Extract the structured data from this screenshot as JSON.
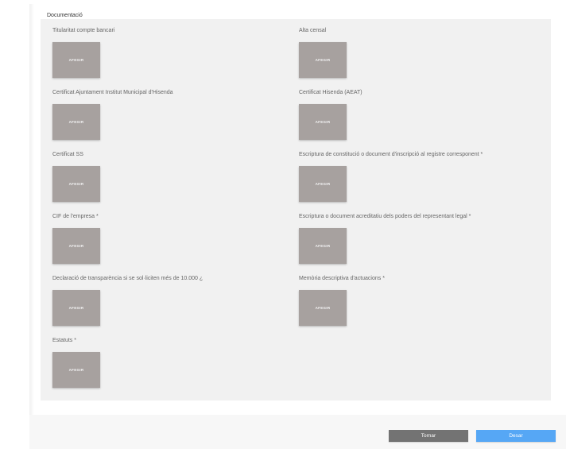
{
  "section": {
    "title": "Documentació"
  },
  "add_label": "AFEGIR",
  "documents": [
    {
      "label": "Titularitat compte bancari"
    },
    {
      "label": "Alta censal"
    },
    {
      "label": "Certificat Ajuntament Institut Municipal d'Hisenda"
    },
    {
      "label": "Certificat Hisenda (AEAT)"
    },
    {
      "label": "Certificat SS"
    },
    {
      "label": "Escriptura de constitució o document d'inscripció al registre corresponent *"
    },
    {
      "label": "CIF de l'empresa *"
    },
    {
      "label": "Escriptura o document acreditatiu dels poders del representant legal *"
    },
    {
      "label": "Declaració de transparència si se sol·liciten més de 10.000 ¿"
    },
    {
      "label": "Memòria descriptiva d'actuacions *"
    },
    {
      "label": "Estatuts *"
    }
  ],
  "footer": {
    "back_label": "Tornar",
    "save_label": "Desar"
  },
  "colors": {
    "panel": "#f1f1f1",
    "add_button": "#a7a19f",
    "back_button": "#737373",
    "save_button": "#56a7f5"
  }
}
